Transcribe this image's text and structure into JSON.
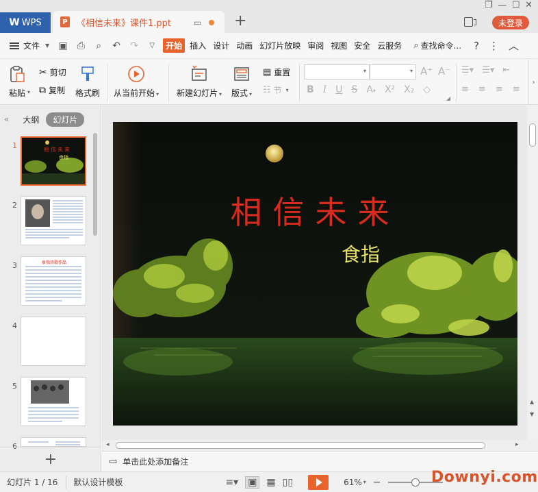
{
  "titlebar": {
    "app_tab": "WPS",
    "doc_tab_title": "《相信未来》课件1.ppt",
    "login": "未登录"
  },
  "menubar": {
    "file": "文件",
    "items": [
      "开始",
      "插入",
      "设计",
      "动画",
      "幻灯片放映",
      "审阅",
      "视图",
      "安全",
      "云服务"
    ],
    "search": "查找命令..."
  },
  "ribbon": {
    "paste": "粘贴",
    "cut": "剪切",
    "copy": "复制",
    "format_painter": "格式刷",
    "from_current": "从当前开始",
    "new_slide": "新建幻灯片",
    "layout": "版式",
    "reset": "重置",
    "section": "节"
  },
  "leftpanel": {
    "tab_outline": "大纲",
    "tab_slides": "幻灯片",
    "slide_numbers": [
      "1",
      "2",
      "3",
      "4",
      "5",
      "6"
    ],
    "thumb1_title": "相信未来",
    "thumb1_author": "食指",
    "thumb3_title": "食指诗歌作品"
  },
  "slide": {
    "title": "相信未来",
    "author": "食指"
  },
  "notes": {
    "placeholder": "单击此处添加备注"
  },
  "statusbar": {
    "slide_counter": "幻灯片 1 / 16",
    "template": "默认设计模板",
    "zoom": "61%"
  },
  "watermark": "Downyi.com",
  "colors": {
    "accent": "#e8642c",
    "wps_blue": "#2f62ac",
    "title_red": "#d62b1e",
    "author_yellow": "#e9e36a"
  }
}
